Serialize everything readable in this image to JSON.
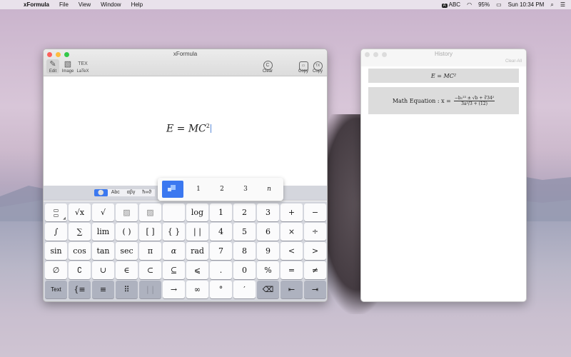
{
  "menubar": {
    "apple": "",
    "items": [
      "xFormula",
      "File",
      "View",
      "Window",
      "Help"
    ],
    "input_badge": "A",
    "input_label": "ABC",
    "battery": "95%",
    "clock": "Sun 10:34 PM"
  },
  "main_window": {
    "title": "xFormula",
    "toolbar_left": [
      {
        "label": "Edit",
        "icon": "✎"
      },
      {
        "label": "Image",
        "icon": "▧"
      },
      {
        "label": "LaTeX",
        "icon": "TEX"
      }
    ],
    "toolbar_right": [
      {
        "label": "Clear",
        "icon": "C"
      },
      {
        "label": "Copy",
        "icon": "▭"
      },
      {
        "label": "Copy",
        "icon": "TX"
      }
    ],
    "formula": {
      "base": "E = MC",
      "exponent": "2"
    },
    "segments": [
      "⚪",
      "Abc",
      "αβγ",
      "ħ∞ϑ"
    ],
    "popup_items": [
      "1",
      "2",
      "3",
      "n"
    ],
    "keys": [
      [
        "÷frac",
        "√x",
        "√",
        "▨",
        "▨",
        "",
        "log",
        "1",
        "2",
        "3",
        "+",
        "−"
      ],
      [
        "∫",
        "∑",
        "lim",
        "( )",
        "[ ]",
        "{ }",
        "| |",
        "4",
        "5",
        "6",
        "×",
        "÷"
      ],
      [
        "sin",
        "cos",
        "tan",
        "sec",
        "π",
        "α",
        "rad",
        "7",
        "8",
        "9",
        "<",
        ">"
      ],
      [
        "∅",
        "∁",
        "∪",
        "∈",
        "⊂",
        "⊆",
        "⩽",
        ".",
        "0",
        "%",
        "=",
        "≠"
      ],
      [
        "Text",
        "{≡",
        "≡",
        "⠿",
        "| |",
        "→",
        "∞",
        "°",
        "′",
        "⌫",
        "⇤",
        "⇥"
      ]
    ]
  },
  "history_window": {
    "title": "History",
    "clear_all": "Clear-All",
    "entry1": "E = MC²",
    "entry2_label": "Math Equation : x =",
    "entry2_num": "−b₁²³ ± √b + ∛34²",
    "entry2_den": "3a²/3 + (12)"
  },
  "accent_color": "#3b78f0"
}
